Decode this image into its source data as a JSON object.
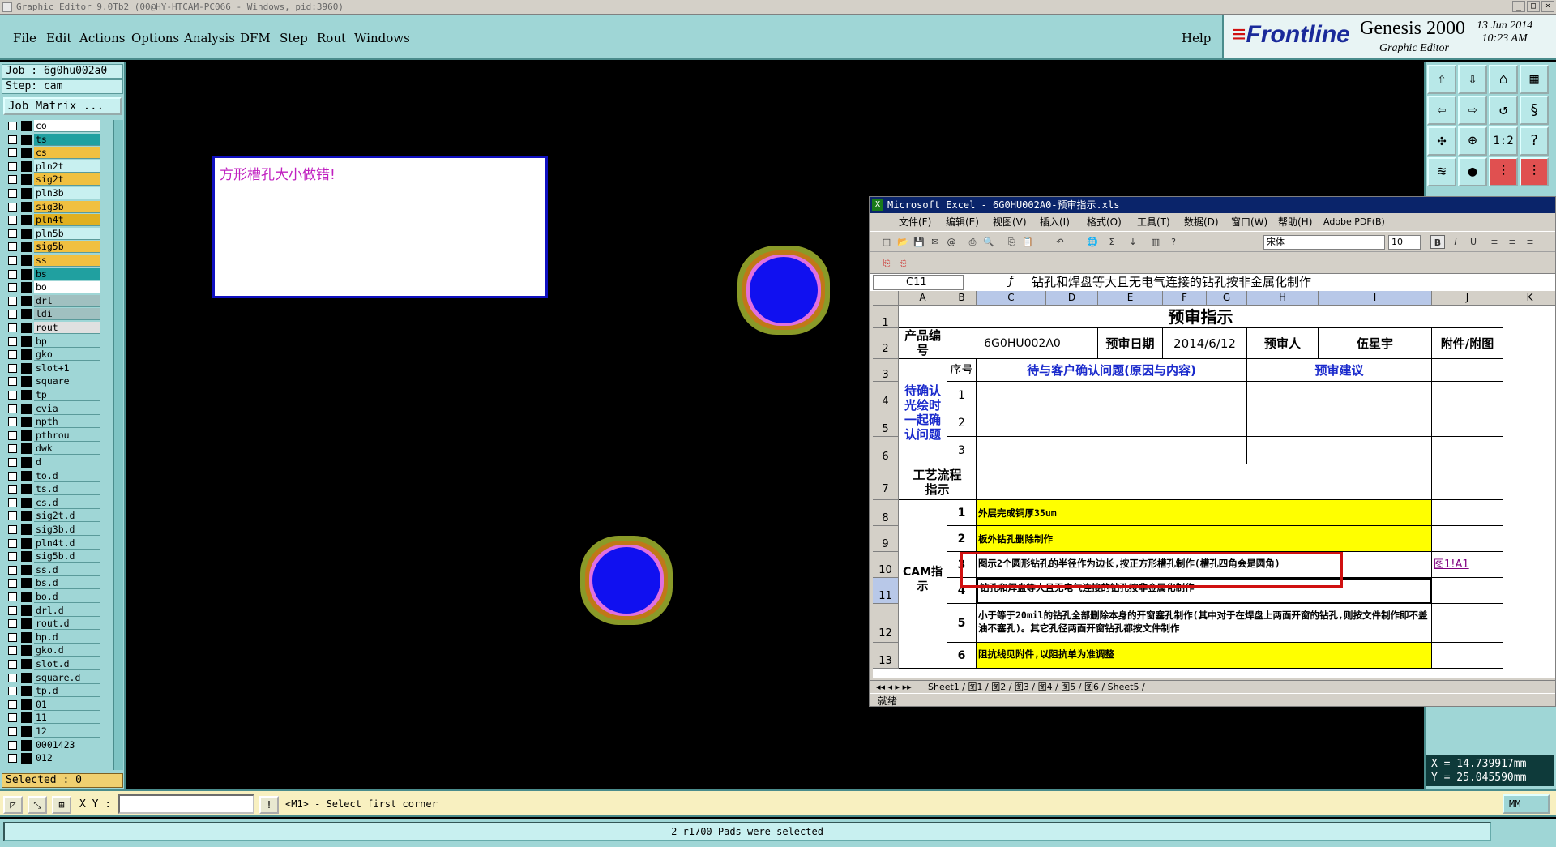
{
  "window_title": "Graphic Editor 9.0Tb2 (00@HY-HTCAM-PC066 - Windows, pid:3960)",
  "menu": [
    "File",
    "Edit",
    "Actions",
    "Options",
    "Analysis",
    "DFM",
    "Step",
    "Rout",
    "Windows",
    "Help"
  ],
  "brand": {
    "logo": "Frontline",
    "product": "Genesis 2000",
    "subtitle": "Graphic Editor",
    "date": "13 Jun 2014",
    "time": "10:23 AM"
  },
  "job": {
    "job_label": "Job : 6g0hu002a0",
    "step_label": "Step: cam",
    "matrix_button": "Job Matrix ..."
  },
  "layers": [
    {
      "name": "co",
      "color": "#ffffff"
    },
    {
      "name": "ts",
      "color": "#20a0a0"
    },
    {
      "name": "cs",
      "color": "#f0c040"
    },
    {
      "name": "pln2t",
      "color": "#c8f0f0"
    },
    {
      "name": "sig2t",
      "color": "#f0c040"
    },
    {
      "name": "pln3b",
      "color": "#c8f0f0"
    },
    {
      "name": "sig3b",
      "color": "#f0c040"
    },
    {
      "name": "pln4t",
      "color": "#e0b020"
    },
    {
      "name": "pln5b",
      "color": "#c8f0f0"
    },
    {
      "name": "sig5b",
      "color": "#f0c040"
    },
    {
      "name": "ss",
      "color": "#f0c040"
    },
    {
      "name": "bs",
      "color": "#20a0a0"
    },
    {
      "name": "bo",
      "color": "#ffffff"
    },
    {
      "name": "drl",
      "color": "#a0c0c0"
    },
    {
      "name": "ldi",
      "color": "#a0c0c0"
    },
    {
      "name": "rout",
      "color": "#e0e0e0"
    },
    {
      "name": "bp",
      "color": "#9fd6d6"
    },
    {
      "name": "gko",
      "color": "#9fd6d6"
    },
    {
      "name": "slot+1",
      "color": "#9fd6d6"
    },
    {
      "name": "square",
      "color": "#9fd6d6"
    },
    {
      "name": "tp",
      "color": "#9fd6d6"
    },
    {
      "name": "cvia",
      "color": "#9fd6d6"
    },
    {
      "name": "npth",
      "color": "#9fd6d6"
    },
    {
      "name": "pthrou",
      "color": "#9fd6d6"
    },
    {
      "name": "dwk",
      "color": "#9fd6d6"
    },
    {
      "name": "d",
      "color": "#9fd6d6"
    },
    {
      "name": "to.d",
      "color": "#9fd6d6"
    },
    {
      "name": "ts.d",
      "color": "#9fd6d6"
    },
    {
      "name": "cs.d",
      "color": "#9fd6d6"
    },
    {
      "name": "sig2t.d",
      "color": "#9fd6d6"
    },
    {
      "name": "sig3b.d",
      "color": "#9fd6d6"
    },
    {
      "name": "pln4t.d",
      "color": "#9fd6d6"
    },
    {
      "name": "sig5b.d",
      "color": "#9fd6d6"
    },
    {
      "name": "ss.d",
      "color": "#9fd6d6"
    },
    {
      "name": "bs.d",
      "color": "#9fd6d6"
    },
    {
      "name": "bo.d",
      "color": "#9fd6d6"
    },
    {
      "name": "drl.d",
      "color": "#9fd6d6"
    },
    {
      "name": "rout.d",
      "color": "#9fd6d6"
    },
    {
      "name": "bp.d",
      "color": "#9fd6d6"
    },
    {
      "name": "gko.d",
      "color": "#9fd6d6"
    },
    {
      "name": "slot.d",
      "color": "#9fd6d6"
    },
    {
      "name": "square.d",
      "color": "#9fd6d6"
    },
    {
      "name": "tp.d",
      "color": "#9fd6d6"
    },
    {
      "name": "01",
      "color": "#9fd6d6"
    },
    {
      "name": "11",
      "color": "#9fd6d6"
    },
    {
      "name": "12",
      "color": "#9fd6d6"
    },
    {
      "name": "0001423",
      "color": "#9fd6d6"
    },
    {
      "name": "012",
      "color": "#9fd6d6"
    }
  ],
  "selected_label": "Selected : 0",
  "canvas_message": "方形槽孔大小做错!",
  "coords": {
    "x": "X = 14.739917mm",
    "y": "Y = 25.045590mm"
  },
  "excel": {
    "title": "Microsoft Excel - 6G0HU002A0-预审指示.xls",
    "menu": [
      "文件(F)",
      "编辑(E)",
      "视图(V)",
      "插入(I)",
      "格式(O)",
      "工具(T)",
      "数据(D)",
      "窗口(W)",
      "帮助(H)",
      "Adobe PDF(B)"
    ],
    "font": "宋体",
    "size": "10",
    "name_box": "C11",
    "formula": "钻孔和焊盘等大且无电气连接的钻孔按非金属化制作",
    "columns": [
      "A",
      "B",
      "C",
      "D",
      "E",
      "F",
      "G",
      "H",
      "I",
      "J",
      "K"
    ],
    "rows": [
      "1",
      "2",
      "3",
      "4",
      "5",
      "6",
      "7",
      "8",
      "9",
      "10",
      "11",
      "12",
      "13"
    ],
    "sheet_title": "预审指示",
    "product_label": "产品编号",
    "product_no": "6G0HU002A0",
    "review_date_label": "预审日期",
    "review_date": "2014/6/12",
    "reviewer_label": "预审人",
    "reviewer": "伍星宇",
    "attachment_label": "附件/附图",
    "pending_label": "待确认光绘时一起确认问题",
    "seq_label": "序号",
    "question_label": "待与客户确认问题(原因与内容)",
    "suggest_label": "预审建议",
    "pending_rows": [
      "1",
      "2",
      "3"
    ],
    "process_label": "工艺流程指示",
    "cam_label": "CAM指示",
    "cam_rows": [
      {
        "no": "1",
        "text": "外层完成铜厚35um",
        "highlight": true,
        "link": ""
      },
      {
        "no": "2",
        "text": "板外钻孔删除制作",
        "highlight": true,
        "link": ""
      },
      {
        "no": "3",
        "text": "图示2个圆形钻孔的半径作为边长,按正方形槽孔制作(槽孔四角会是圆角)",
        "highlight": false,
        "link": "图1!A1"
      },
      {
        "no": "4",
        "text": "钻孔和焊盘等大且无电气连接的钻孔按非金属化制作",
        "highlight": false,
        "link": ""
      },
      {
        "no": "5",
        "text": "小于等于20mil的钻孔全部删除本身的开窗塞孔制作(其中对于在焊盘上两面开窗的钻孔,则按文件制作即不盖油不塞孔)。其它孔径两面开窗钻孔都按文件制作",
        "highlight": false,
        "link": ""
      },
      {
        "no": "6",
        "text": "阻抗线见附件,以阻抗单为准调整",
        "highlight": true,
        "link": ""
      }
    ],
    "tabs": "Sheet1 / 图1 / 图2 / 图3 / 图4 / 图5 / 图6 / Sheet5 /",
    "status": "就绪"
  },
  "cmd": {
    "xy_label": "X Y :",
    "prompt": "<M1> - Select first corner",
    "unit": "MM"
  },
  "status_message": "2 r1700 Pads were selected"
}
